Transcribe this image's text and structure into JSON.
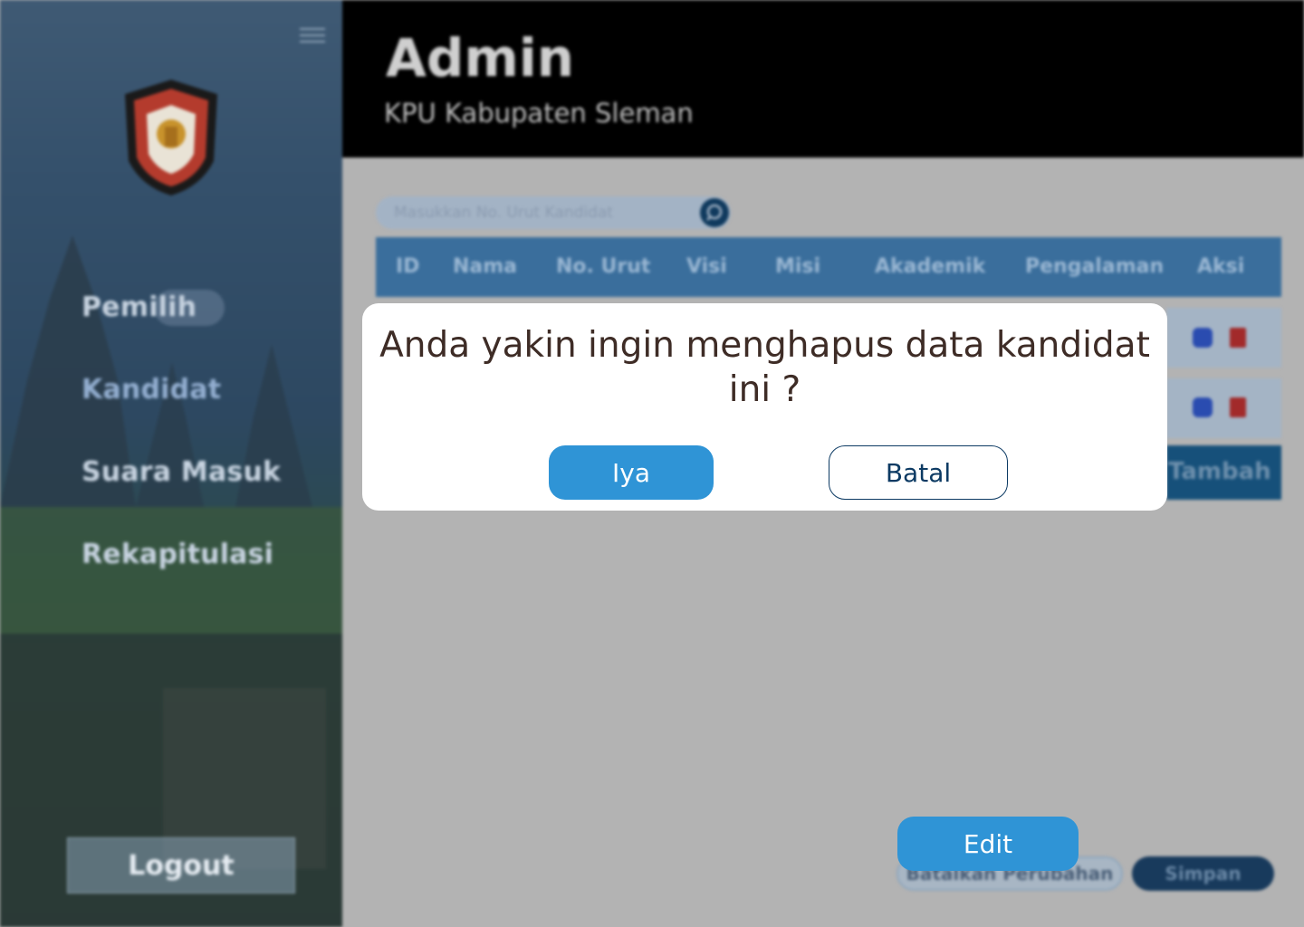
{
  "sidebar": {
    "nav": [
      {
        "label": "Pemilih"
      },
      {
        "label": "Kandidat"
      },
      {
        "label": "Suara Masuk"
      },
      {
        "label": "Rekapitulasi"
      }
    ],
    "logout_label": "Logout"
  },
  "header": {
    "title": "Admin",
    "subtitle": "KPU Kabupaten Sleman"
  },
  "search": {
    "placeholder": "Masukkan No. Urut Kandidat"
  },
  "table": {
    "columns": [
      "ID",
      "Nama",
      "No. Urut",
      "Visi",
      "Misi",
      "Akademik",
      "Pengalaman",
      "Aksi"
    ],
    "add_label": "Tambah"
  },
  "footer": {
    "edit_label": "Edit",
    "cancel_changes_label": "Batalkan Perubahan",
    "save_label": "Simpan"
  },
  "modal": {
    "message": "Anda yakin ingin menghapus data kandidat ini ?",
    "confirm_label": "Iya",
    "cancel_label": "Batal"
  },
  "colors": {
    "primary": "#2f94d6",
    "dark_blue": "#0c3a63",
    "header_bg": "#000000",
    "overlay": "#b3b3b3"
  }
}
